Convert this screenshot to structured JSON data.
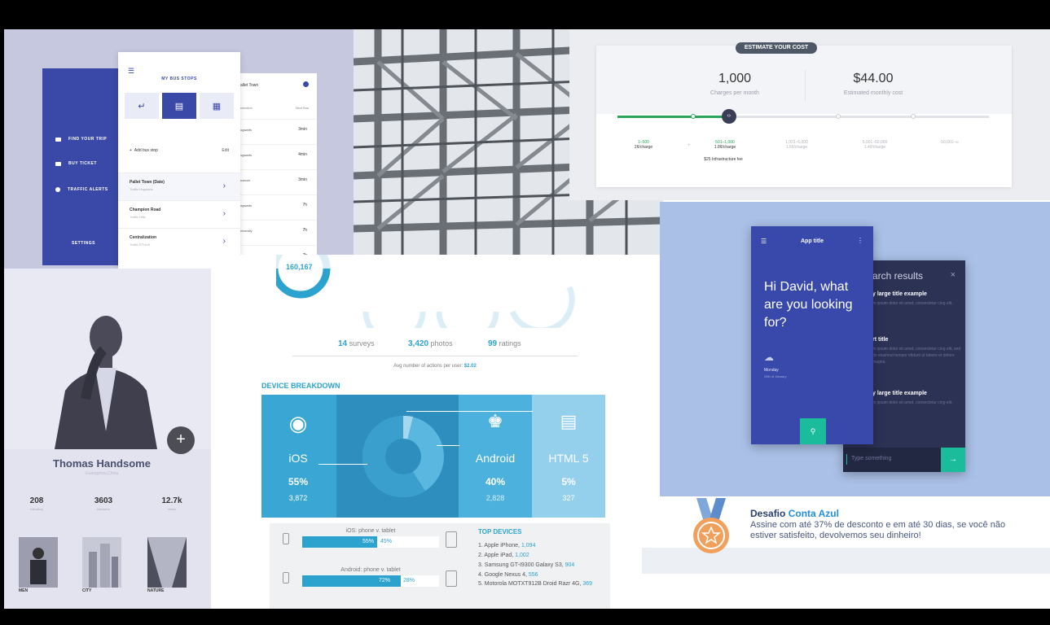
{
  "bus_app": {
    "title": "MY BUS STOPS",
    "sidebar": [
      "FIND YOUR TRIP",
      "BUY TICKET",
      "TRAFFIC ALERTS",
      "SETTINGS"
    ],
    "add_label": "Add bus stop",
    "edit_label": "Edit",
    "stops": [
      {
        "name": "Pallet Town (Date)",
        "sub": "Traffic Hogwarts"
      },
      {
        "name": "Champion Road",
        "sub": "Traffic Hills"
      },
      {
        "name": "Centralization",
        "sub": "Traffic ETHUK"
      }
    ],
    "right_title": "allet Town",
    "right_cols": [
      "stination",
      "Next Bus"
    ],
    "right_rows": [
      {
        "dest": "ogwarts",
        "time": "3min"
      },
      {
        "dest": "ogwarts",
        "time": "4min"
      },
      {
        "dest": "useum",
        "time": "3min"
      },
      {
        "dest": "ogwarts",
        "time": "7h"
      },
      {
        "dest": "niversity",
        "time": "7h"
      },
      {
        "dest": "ogwarts",
        "time": "7h"
      }
    ]
  },
  "cost": {
    "badge": "ESTIMATE YOUR COST",
    "charges_value": "1,000",
    "charges_label": "Charges per month",
    "cost_value": "$44.00",
    "cost_label": "Estimated monthly cost",
    "slider_level": 0.3,
    "tiers": [
      {
        "range": "1–500",
        "price": "2¢/charge"
      },
      {
        "range": "501–1,000",
        "price": "1.8¢/charge"
      },
      {
        "range": "1,001–5,000",
        "price": "1.6¢/charge"
      },
      {
        "range": "5,001–50,000",
        "price": "1.4¢/charge"
      },
      {
        "range": "50,001–∞",
        "price": ""
      }
    ],
    "plus": "+",
    "fee": "$25 Infrastructure fee"
  },
  "profile": {
    "name": "Thomas Handsome",
    "location": "Guangzhou,China",
    "stats": [
      {
        "value": "208",
        "label": "following"
      },
      {
        "value": "3603",
        "label": "followers"
      },
      {
        "value": "12.7k",
        "label": "views"
      }
    ],
    "thumbs": [
      "MEN",
      "CITY",
      "NATURE"
    ]
  },
  "info": {
    "big_number": "160,167",
    "surveys_num": "14",
    "surveys_label": "surveys",
    "photos_num": "3,420",
    "photos_label": "photos",
    "ratings_num": "99",
    "ratings_label": "ratings",
    "avg_label": "Avg number of actions per user:",
    "avg_value": "$2.02",
    "device_title": "DEVICE BREAKDOWN",
    "devices": [
      {
        "name": "iOS",
        "pct": "55%",
        "count": "3,872"
      },
      {
        "name": "Android",
        "pct": "40%",
        "count": "2,828"
      },
      {
        "name": "HTML 5",
        "pct": "5%",
        "count": "327"
      }
    ],
    "bars": [
      {
        "label": "iOS: phone v. tablet",
        "a": "55%",
        "b": "45%",
        "fill": 0.55
      },
      {
        "label": "Android: phone v. tablet",
        "a": "72%",
        "b": "28%",
        "fill": 0.72
      }
    ],
    "top_title": "TOP DEVICES",
    "top_devices": [
      {
        "name": "1. Apple iPhone,",
        "val": "1,094"
      },
      {
        "name": "2. Apple iPad,",
        "val": "1,002"
      },
      {
        "name": "3. Samsung GT-I9300 Galaxy S3,",
        "val": "904"
      },
      {
        "name": "4. Google Nexus 4,",
        "val": "556"
      },
      {
        "name": "5. Motorola MOTXT912B Droid Razr 4G,",
        "val": "369"
      }
    ]
  },
  "app": {
    "title": "App title",
    "greeting": "Hi David, what are you looking for?",
    "day": "Monday",
    "date": "25th of January",
    "search_title": "arch results",
    "results": [
      {
        "title": "y large title example",
        "text": "m ipsum dolor sit amet, consectetur cing elit."
      },
      {
        "title": "rt title",
        "text": "m ipsum dolor sit amet, consectetur cing elit, sed do eiusmod tempor ididunt ut labore et dolore magna."
      },
      {
        "title": "y large title example",
        "text": "m ipsum dolor sit amet, consectetur cing elit."
      }
    ],
    "input_placeholder": "Type something"
  },
  "desafio": {
    "title_a": "Desafio",
    "title_b": "Conta Azul",
    "text": "Assine com até 37% de desconto e em até 30 dias, se você não estiver satisfeito, devolvemos seu dinheiro!"
  },
  "colors": {
    "bus": "#3a49a8",
    "green": "#28a55b",
    "cyan": "#2ca3ce",
    "app": "#3949ab",
    "teal": "#1abc9c"
  }
}
